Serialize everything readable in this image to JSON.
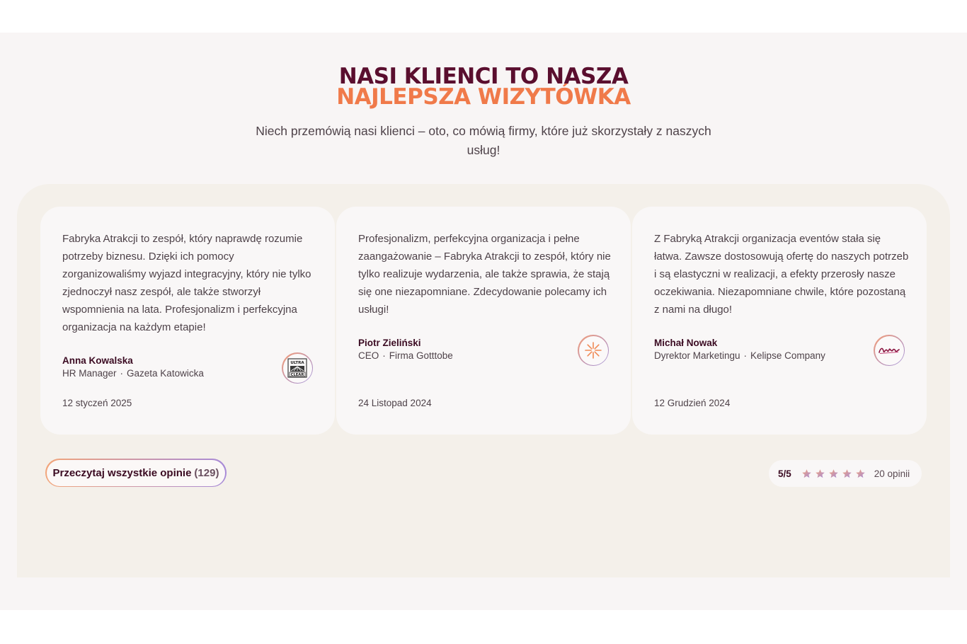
{
  "header": {
    "title_line1": "NASI KLIENCI TO NASZA",
    "title_line2": "NAJLEPSZA WIZYTÓWKA",
    "subtitle": "Niech przemówią nasi klienci – oto, co mówią firmy, które już skorzystały z naszych usług!"
  },
  "testimonials": [
    {
      "quote": "Fabryka Atrakcji to zespół, który naprawdę rozumie potrzeby biznesu. Dzięki ich pomocy zorganizowaliśmy wyjazd integracyjny, który nie tylko zjednoczył nasz zespół, ale także stworzył wspomnienia na lata. Profesjonalizm i perfekcyjna organizacja na każdym etapie!",
      "author": "Anna Kowalska",
      "position": "HR Manager",
      "company": "Gazeta Katowicka",
      "date": "12 styczeń 2025",
      "logo_icon": "ultra-clear-logo",
      "logo_text_top": "ULTRA",
      "logo_text_bottom": "CLEAR"
    },
    {
      "quote": "Profesjonalizm, perfekcyjna organizacja i pełne zaangażowanie – Fabryka Atrakcji to zespół, który nie tylko realizuje wydarzenia, ale także sprawia, że stają się one niezapomniane. Zdecydowanie polecamy ich usługi!",
      "author": "Piotr Zieliński",
      "position": "CEO",
      "company": "Firma Gotttobe",
      "date": "24 Listopad 2024",
      "logo_icon": "starburst-logo"
    },
    {
      "quote": "Z Fabryką Atrakcji organizacja eventów stała się łatwa. Zawsze dostosowują ofertę do naszych potrzeb i są elastyczni w realizacji, a efekty przerosły nasze oczekiwania. Niezapomniane chwile, które pozostaną z nami na długo!",
      "author": "Michał Nowak",
      "position": "Dyrektor Marketingu",
      "company": "Kelipse Company",
      "date": "12 Grudzień 2024",
      "logo_icon": "script-wordmark-logo"
    }
  ],
  "footer": {
    "read_all_label": "Przeczytaj wszystkie opinie",
    "read_all_count": "(129)",
    "rating_score": "5/5",
    "rating_value": 5,
    "rating_max": 5,
    "reviews_count": "20 opinii"
  },
  "colors": {
    "title_dark": "#5a0e2e",
    "title_accent": "#f07a4a",
    "panel_bg": "#f4f0ea",
    "card_bg": "#f9f7f7"
  }
}
